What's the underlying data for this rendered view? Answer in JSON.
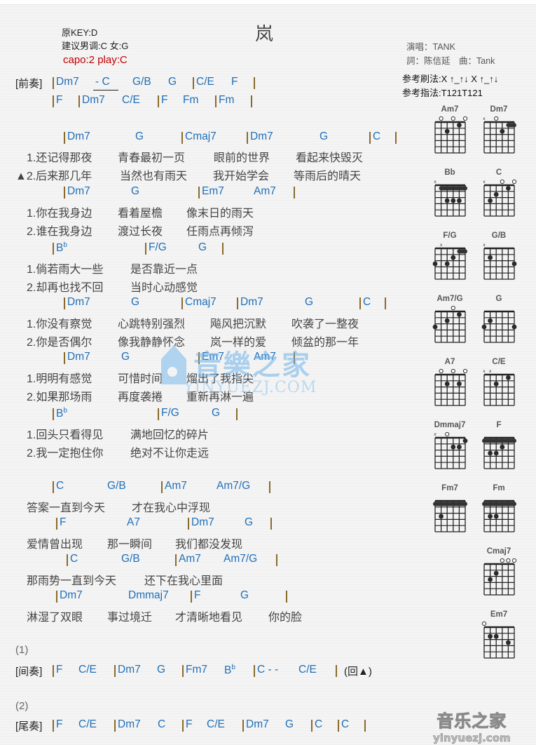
{
  "title": "岚",
  "meta": {
    "original_key": "原KEY:D",
    "suggested_key": "建议男调:C 女:G",
    "capo": "capo:2 play:C"
  },
  "credits": {
    "singer": "演唱：TANK",
    "lyricist_composer": "詞：陈信延　曲：Tank"
  },
  "reference": {
    "strum": "参考刷法:X ↑_↑↓ X ↑_↑↓",
    "finger": "参考指法:T121T121"
  },
  "intro": {
    "label": "[前奏]",
    "row1": [
      "Dm7",
      "-  C",
      "G/B",
      "G",
      "C/E",
      "F"
    ],
    "row2": [
      "F",
      "Dm7",
      "C/E",
      "F",
      "Fm",
      "Fm"
    ]
  },
  "verse1": {
    "chords": [
      "Dm7",
      "G",
      "Cmaj7",
      "Dm7",
      "G",
      "C"
    ],
    "lyrics1": [
      "1.还记得那夜",
      "青春最初一页",
      "眼前的世界",
      "看起来快毁灭"
    ],
    "lyrics2": [
      "▲2.后来那几年",
      "当然也有雨天",
      "我开始学会",
      "等雨后的晴天"
    ]
  },
  "verse2": {
    "chords": [
      "Dm7",
      "G",
      "Em7",
      "Am7"
    ],
    "lyrics1": [
      "1.你在我身边",
      "看着屋檐",
      "像末日的雨天"
    ],
    "lyrics2": [
      "2.谁在我身边",
      "渡过长夜",
      "任雨点再倾泻"
    ]
  },
  "verse3": {
    "chords": [
      "B",
      "F/G",
      "G"
    ],
    "flat": "b",
    "lyrics1": [
      "1.倘若雨大一些",
      "是否靠近一点"
    ],
    "lyrics2": [
      "2.却再也找不回",
      "当时心动感觉"
    ]
  },
  "verse4": {
    "chords": [
      "Dm7",
      "G",
      "Cmaj7",
      "Dm7",
      "G",
      "C"
    ],
    "lyrics1": [
      "1.你没有察觉",
      "心跳特别强烈",
      "飚风把沉默",
      "吹袭了一整夜"
    ],
    "lyrics2": [
      "2.你是否偶尔",
      "像我静静怀念",
      "岚一样的爱",
      "倾盆的那一年"
    ]
  },
  "verse5": {
    "chords": [
      "Dm7",
      "G",
      "Em7",
      "Am7"
    ],
    "lyrics1": [
      "1.明明有感觉",
      "可惜时间",
      "熘出了我指尖"
    ],
    "lyrics2": [
      "2.如果那场雨",
      "再度袭捲",
      "重新再淋一遍"
    ]
  },
  "verse6": {
    "chords": [
      "B",
      "F/G",
      "G"
    ],
    "flat": "b",
    "lyrics1": [
      "1.回头只看得见",
      "满地回忆的碎片"
    ],
    "lyrics2": [
      "2.我一定抱住你",
      "绝对不让你走远"
    ]
  },
  "chorus1": {
    "chords": [
      "C",
      "G/B",
      "Am7",
      "Am7/G"
    ],
    "lyrics": [
      "答案一直到今天",
      "才在我心中浮现"
    ]
  },
  "chorus2": {
    "chords": [
      "F",
      "A7",
      "Dm7",
      "G"
    ],
    "lyrics": [
      "爱情曾出现",
      "那一瞬间",
      "我们都没发现"
    ]
  },
  "chorus3": {
    "chords": [
      "C",
      "G/B",
      "Am7",
      "Am7/G"
    ],
    "lyrics": [
      "那雨势一直到今天",
      "还下在我心里面"
    ]
  },
  "chorus4": {
    "chords": [
      "Dm7",
      "Dmmaj7",
      "F",
      "G"
    ],
    "lyrics": [
      "淋湿了双眼",
      "事过境迁",
      "才清晰地看见",
      "你的脸"
    ]
  },
  "interlude": {
    "number": "(1)",
    "label": "[间奏]",
    "chords": [
      "F",
      "C/E",
      "Dm7",
      "G",
      "Fm7",
      "B",
      "C  -  -",
      "C/E"
    ],
    "flat": "b",
    "return": "(回▲)"
  },
  "outro": {
    "number": "(2)",
    "label": "[尾奏]",
    "chords": [
      "F",
      "C/E",
      "Dm7",
      "C",
      "F",
      "C/E",
      "Dm7",
      "G",
      "C",
      "C"
    ]
  },
  "chord_diagrams": [
    {
      "name": "Am7",
      "mute": [],
      "open": [
        1,
        3,
        5
      ],
      "barre": null,
      "dots": [
        [
          4,
          1
        ],
        [
          2,
          2
        ]
      ]
    },
    {
      "name": "Dm7",
      "mute": [
        0
      ],
      "open": [
        2
      ],
      "barre": {
        "fret": 1,
        "from": 4,
        "to": 5
      },
      "dots": [
        [
          3,
          2
        ]
      ]
    },
    {
      "name": "Bb",
      "mute": [
        0
      ],
      "open": [],
      "barre": {
        "fret": 1,
        "from": 1,
        "to": 5
      },
      "dots": [
        [
          2,
          3
        ],
        [
          3,
          3
        ],
        [
          4,
          3
        ]
      ]
    },
    {
      "name": "C",
      "mute": [
        0
      ],
      "open": [
        3,
        5
      ],
      "barre": null,
      "dots": [
        [
          4,
          1
        ],
        [
          2,
          2
        ],
        [
          1,
          3
        ]
      ]
    },
    {
      "name": "F/G",
      "mute": [
        1
      ],
      "open": [],
      "barre": {
        "fret": 1,
        "from": 4,
        "to": 5
      },
      "dots": [
        [
          3,
          2
        ],
        [
          0,
          3
        ],
        [
          2,
          3
        ]
      ]
    },
    {
      "name": "G/B",
      "mute": [
        0
      ],
      "open": [],
      "barre": null,
      "dots": [
        [
          1,
          2
        ],
        [
          5,
          3
        ]
      ]
    },
    {
      "name": "Am7/G",
      "mute": [],
      "open": [
        3
      ],
      "barre": null,
      "dots": [
        [
          4,
          1
        ],
        [
          2,
          2
        ],
        [
          0,
          3
        ]
      ]
    },
    {
      "name": "G",
      "mute": [],
      "open": [],
      "barre": null,
      "dots": [
        [
          1,
          2
        ],
        [
          0,
          3
        ],
        [
          5,
          3
        ]
      ]
    },
    {
      "name": "A7",
      "mute": [],
      "open": [
        1,
        3,
        5
      ],
      "barre": null,
      "dots": [
        [
          2,
          2
        ],
        [
          4,
          2
        ]
      ]
    },
    {
      "name": "C/E",
      "mute": [
        0,
        1
      ],
      "open": [],
      "barre": null,
      "dots": [
        [
          4,
          1
        ],
        [
          2,
          2
        ]
      ]
    },
    {
      "name": "Dmmaj7",
      "mute": [
        0
      ],
      "open": [
        2
      ],
      "barre": null,
      "dots": [
        [
          5,
          1
        ],
        [
          3,
          2
        ],
        [
          4,
          2
        ]
      ]
    },
    {
      "name": "F",
      "mute": [],
      "open": [],
      "barre": {
        "fret": 1,
        "from": 0,
        "to": 5
      },
      "dots": [
        [
          3,
          2
        ],
        [
          1,
          3
        ],
        [
          2,
          3
        ]
      ]
    },
    {
      "name": "Fm7",
      "mute": [],
      "open": [],
      "barre": {
        "fret": 1,
        "from": 0,
        "to": 5
      },
      "dots": [
        [
          1,
          3
        ]
      ]
    },
    {
      "name": "Fm",
      "mute": [],
      "open": [],
      "barre": {
        "fret": 1,
        "from": 0,
        "to": 5
      },
      "dots": [
        [
          1,
          3
        ],
        [
          2,
          3
        ]
      ]
    },
    {
      "name": "Cmaj7",
      "mute": [],
      "open": [
        3,
        4,
        5
      ],
      "barre": null,
      "dots": [
        [
          2,
          2
        ],
        [
          1,
          3
        ]
      ]
    },
    {
      "name": "Em7",
      "mute": [],
      "open": [
        0
      ],
      "barre": null,
      "dots": [
        [
          1,
          2
        ],
        [
          2,
          2
        ],
        [
          4,
          3
        ]
      ]
    }
  ],
  "watermark": {
    "cn": "音樂之家",
    "en": "YINYUEZJ.COM"
  },
  "footer_logo": {
    "cn": "音乐之家",
    "en": "yinyuezj.com"
  }
}
